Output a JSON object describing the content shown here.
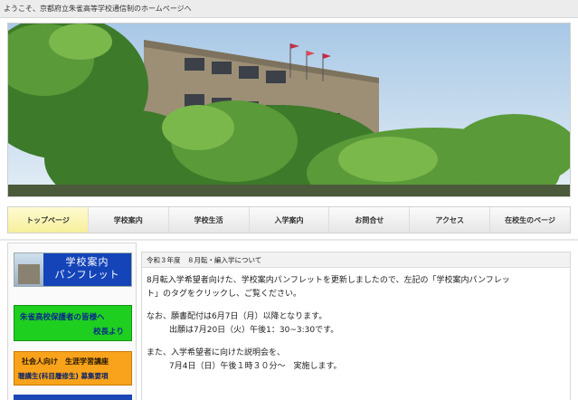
{
  "header": {
    "welcome": "ようこそ、京都府立朱雀高等学校通信制のホームページへ"
  },
  "nav": {
    "items": [
      "トップページ",
      "学校案内",
      "学校生活",
      "入学案内",
      "お問合せ",
      "アクセス",
      "在校生のページ"
    ],
    "active_index": 0
  },
  "sidebar": {
    "brochure_line1": "学校案内",
    "brochure_line2": "パンフレット",
    "parents_line1": "朱雀高校保護者の皆様へ",
    "parents_line2": "校長より",
    "course_line1": "社会人向け　生涯学習講座",
    "course_line2": "聴講生(科目履修生) 募集要項"
  },
  "content": {
    "heading": "令和３年度　８月転・編入学について",
    "p1_line1": "8月転入学希望者向けた、学校案内パンフレットを更新しましたので、左記の「学校案内パンフレッ",
    "p1_line2": "ト」のタグをクリックし、ご覧ください。",
    "p2_line1": "なお、願書配付は6月7日（月）以降となります。",
    "p2_line2": "出願は7月20日（火）午後1：30~3:30です。",
    "p3_line1": "また、入学希望者に向けた説明会を、",
    "p3_line2": "7月4日（日）午後１時３０分～　実施します。"
  },
  "colors": {
    "nav_active": "#f6ef9c",
    "brochure_blue": "#1444b8",
    "parents_green": "#1fcf1f",
    "course_orange": "#f8a31b"
  }
}
